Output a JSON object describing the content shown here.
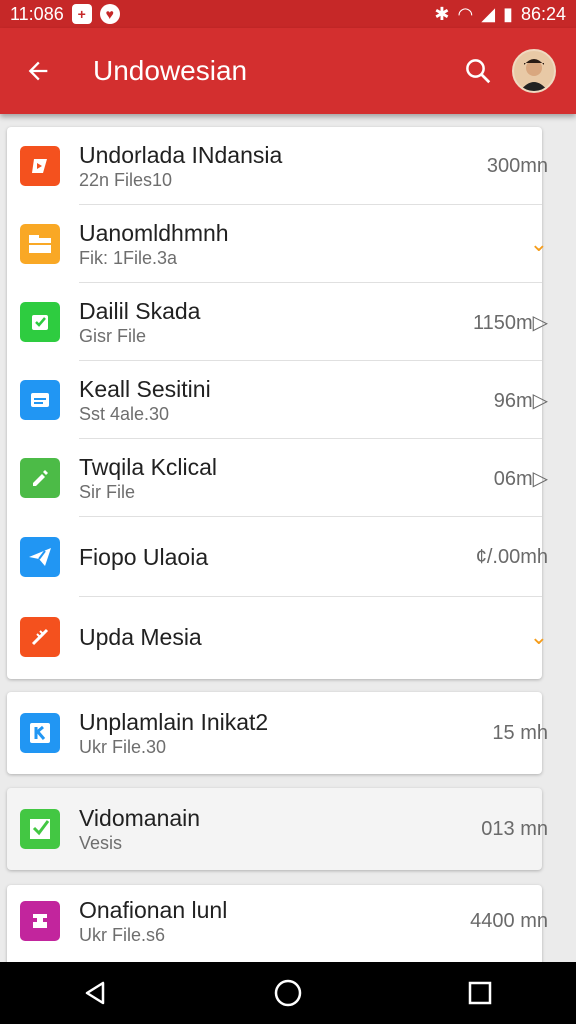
{
  "status_bar": {
    "time": "11:086",
    "clock": "86:24",
    "left_badges": [
      "+",
      "♥"
    ]
  },
  "app_bar": {
    "title": "Undowesian",
    "back_icon": "arrow-left-icon",
    "search_icon": "search-icon"
  },
  "group1": [
    {
      "title": "Undorlada INdansia",
      "subtitle": "22n Files10",
      "meta": "300mn",
      "icon_color": "#f4511e",
      "icon": "play-icon"
    },
    {
      "title": "Uanomldhmnh",
      "subtitle": "Fik: 1File.3a",
      "meta": "⌄",
      "icon_color": "#f9a825",
      "icon": "folder-icon"
    },
    {
      "title": "Dailil Skada",
      "subtitle": "Gisr File",
      "meta": "1150m▷",
      "icon_color": "#2ecc40",
      "icon": "check-icon"
    },
    {
      "title": "Keall Sesitini",
      "subtitle": "Sst 4ale.30",
      "meta": "96m▷",
      "icon_color": "#2196f3",
      "icon": "file-icon"
    },
    {
      "title": "Twqila Kclical",
      "subtitle": "Sir File",
      "meta": "06m▷",
      "icon_color": "#4cbb47",
      "icon": "pen-icon"
    },
    {
      "title": "Fiopo Ulaoia",
      "subtitle": "",
      "meta": "¢/.00mh",
      "icon_color": "#2196f3",
      "icon": "send-icon"
    },
    {
      "title": "Upda Mesia",
      "subtitle": "",
      "meta": "⌄",
      "icon_color": "#f4511e",
      "icon": "slash-icon"
    }
  ],
  "group2": [
    {
      "title": "Unplamlain Inikat2",
      "subtitle": "Ukr File.30",
      "meta": "15 mh",
      "icon_color": "#2196f3",
      "icon": "k-icon"
    }
  ],
  "group3": [
    {
      "title": "Vidomanain",
      "subtitle": "Vesis",
      "meta": "013 mn",
      "icon_color": "#43c743",
      "icon": "checkbox-icon"
    }
  ],
  "group4": [
    {
      "title": "Onafionan lunl",
      "subtitle": "Ukr File.s6",
      "meta": "4400 mn",
      "icon_color": "#c2259d",
      "icon": "bookmark-icon"
    }
  ],
  "nav": {
    "back": "back-triangle-icon",
    "home": "home-circle-icon",
    "recents": "recents-square-icon"
  }
}
